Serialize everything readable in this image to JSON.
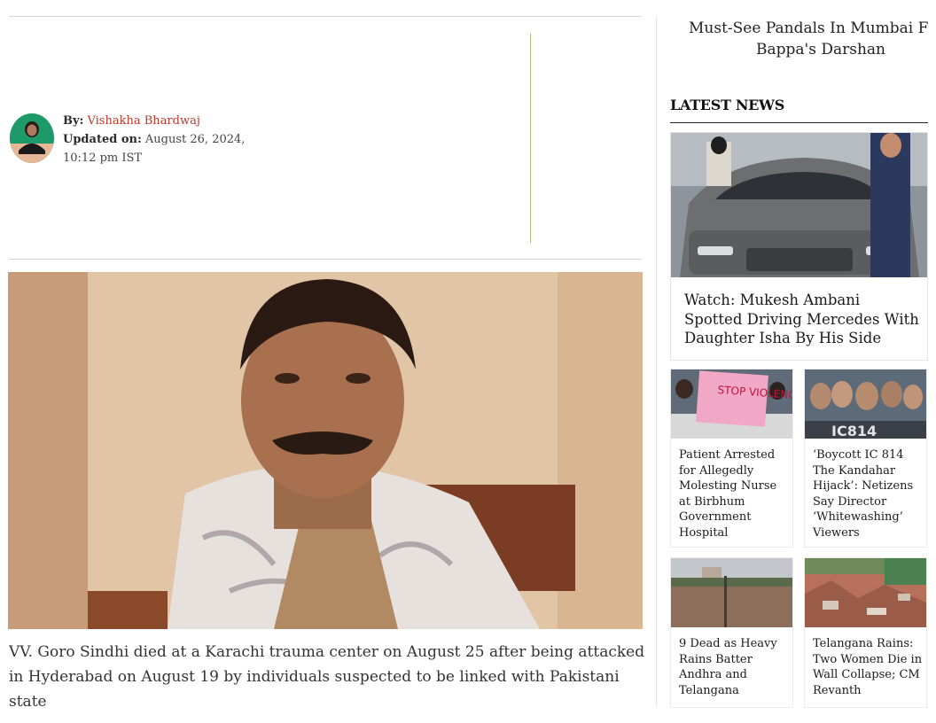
{
  "article": {
    "byline_label": "By:",
    "author": "Vishakha Bhardwaj",
    "updated_label": "Updated on:",
    "updated_value": "August 26, 2024, 10:12 pm IST",
    "caption": "VV. Goro Sindhi died at a Karachi trauma center on August 25 after being attacked in Hyderabad on August 19 by individuals suspected to be linked with Pakistani state"
  },
  "sidebar": {
    "trending_title_line1": "Must-See Pandals In Mumbai F",
    "trending_title_line2": "Bappa's Darshan",
    "latest_heading": "LATEST NEWS",
    "featured": {
      "title": "Watch: Mukesh Ambani Spotted Driving Mercedes With Daughter Isha By His Side"
    },
    "cards": [
      {
        "title": "Patient Arrested for Allegedly Molesting Nurse at Birbhum Government Hospital",
        "image_text": "STOP VIOLENCE"
      },
      {
        "title": "‘Boycott IC 814 The Kandahar Hijack’: Netizens Say Director ‘Whitewashing’ Viewers",
        "image_text": "IC814"
      },
      {
        "title": "9 Dead as Heavy Rains Batter Andhra and Telangana"
      },
      {
        "title": "Telangana Rains: Two Women Die in Wall Collapse; CM Revanth"
      }
    ]
  },
  "colors": {
    "author_link": "#c0392b",
    "rule": "#d4d4d4",
    "ad_divider": "#b8bb7a"
  }
}
